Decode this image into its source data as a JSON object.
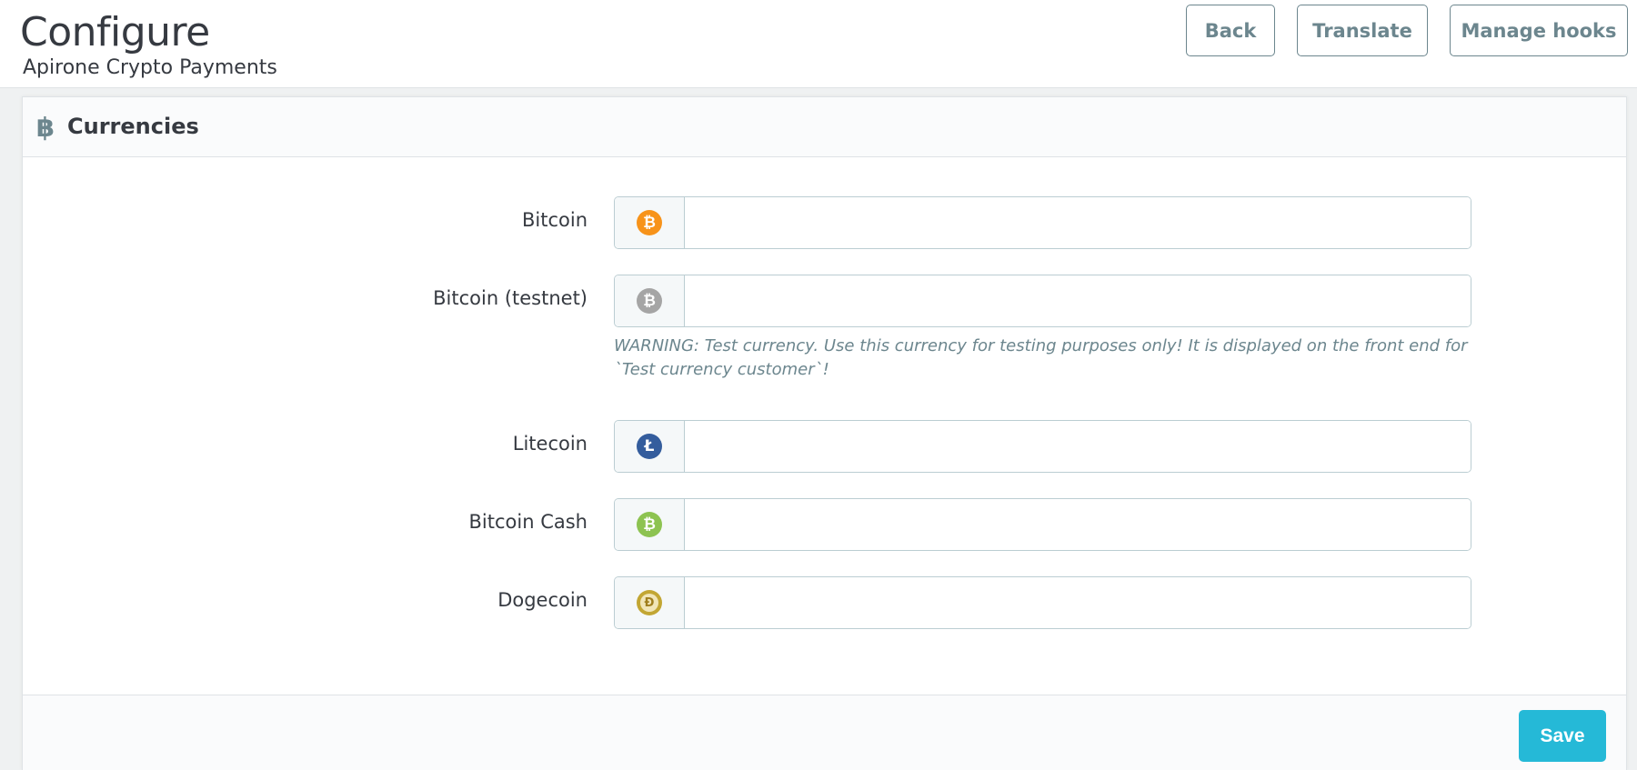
{
  "header": {
    "title": "Configure",
    "subtitle": "Apirone Crypto Payments",
    "toolbar": {
      "back_label": "Back",
      "translate_label": "Translate",
      "manage_hooks_label": "Manage hooks"
    }
  },
  "panel": {
    "heading_icon": "bitcoin-icon",
    "heading_icon_glyph": "฿",
    "title": "Currencies",
    "fields": [
      {
        "label": "Bitcoin",
        "icon": "bitcoin-icon",
        "color": "#f7931a",
        "glyph": "₿",
        "value": "",
        "help": ""
      },
      {
        "label": "Bitcoin (testnet)",
        "icon": "bitcoin-testnet-icon",
        "color": "#a5a5a5",
        "glyph": "₿",
        "value": "",
        "help": "WARNING: Test currency. Use this currency for testing purposes only! It is displayed on the front end for `Test currency customer`!"
      },
      {
        "label": "Litecoin",
        "icon": "litecoin-icon",
        "color": "#345d9d",
        "glyph": "Ł",
        "value": "",
        "help": ""
      },
      {
        "label": "Bitcoin Cash",
        "icon": "bitcoin-cash-icon",
        "color": "#8dc351",
        "glyph": "₿",
        "value": "",
        "help": ""
      },
      {
        "label": "Dogecoin",
        "icon": "dogecoin-icon",
        "color": "#c2a633",
        "glyph": "Ð",
        "value": "",
        "help": ""
      }
    ],
    "save_label": "Save"
  },
  "colors": {
    "accent": "#25b9d7",
    "toolbar_border": "#6c868e",
    "input_border": "#bbcdd2"
  }
}
